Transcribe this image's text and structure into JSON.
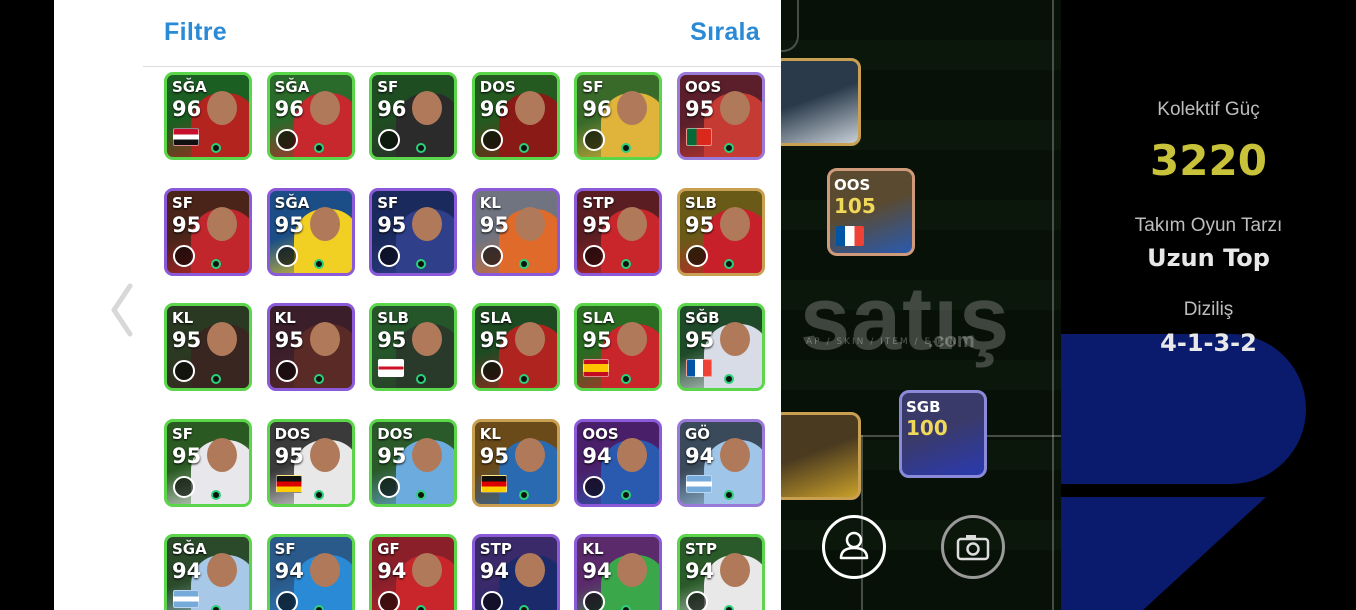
{
  "panel": {
    "filter_label": "Filtre",
    "sort_label": "Sırala"
  },
  "players": [
    {
      "pos": "SĞA",
      "ovr": "96",
      "flag": "egypt",
      "colors": [
        "#1c5f22",
        "#b3241f"
      ]
    },
    {
      "pos": "SĞA",
      "ovr": "96",
      "flag": "",
      "badge": "arsenal",
      "colors": [
        "#2a6a2a",
        "#c7282d"
      ]
    },
    {
      "pos": "SF",
      "ovr": "96",
      "flag": "",
      "badge": "madrid",
      "colors": [
        "#1f4d22",
        "#2b2b2b"
      ]
    },
    {
      "pos": "DOS",
      "ovr": "96",
      "flag": "",
      "badge": "milan",
      "colors": [
        "#245a20",
        "#8a1a16"
      ]
    },
    {
      "pos": "SF",
      "ovr": "96",
      "flag": "",
      "badge": "barcelona",
      "colors": [
        "#3a6a2a",
        "#e0b33a"
      ]
    },
    {
      "pos": "OOS",
      "ovr": "95",
      "flag": "portugal",
      "colors": [
        "#5a1f2a",
        "#c53a32"
      ]
    },
    {
      "pos": "SF",
      "ovr": "95",
      "flag": "",
      "badge": "liverpool",
      "colors": [
        "#4a2418",
        "#c1262d"
      ]
    },
    {
      "pos": "SĞA",
      "ovr": "95",
      "flag": "",
      "badge": "alnassr",
      "colors": [
        "#1b4e86",
        "#f2d023"
      ]
    },
    {
      "pos": "SF",
      "ovr": "95",
      "flag": "",
      "badge": "inter",
      "colors": [
        "#1a2a5c",
        "#2f3f8a"
      ]
    },
    {
      "pos": "KL",
      "ovr": "95",
      "flag": "",
      "badge": "madrid",
      "colors": [
        "#6f7480",
        "#e06a2a"
      ]
    },
    {
      "pos": "STP",
      "ovr": "95",
      "flag": "",
      "badge": "liverpool",
      "colors": [
        "#5a1e22",
        "#c9262b"
      ]
    },
    {
      "pos": "SLB",
      "ovr": "95",
      "flag": "",
      "badge": "manutd",
      "colors": [
        "#6a5a18",
        "#c8202a"
      ]
    },
    {
      "pos": "KL",
      "ovr": "95",
      "flag": "",
      "badge": "liverpool",
      "colors": [
        "#2a3a22",
        "#3a2620"
      ]
    },
    {
      "pos": "KL",
      "ovr": "95",
      "flag": "",
      "badge": "liverpool",
      "colors": [
        "#3a1e2a",
        "#5a2a26"
      ]
    },
    {
      "pos": "SLB",
      "ovr": "95",
      "flag": "england",
      "colors": [
        "#25562a",
        "#2a3a2a"
      ]
    },
    {
      "pos": "SLA",
      "ovr": "95",
      "flag": "",
      "badge": "milan",
      "colors": [
        "#1e4a22",
        "#b0241f"
      ]
    },
    {
      "pos": "SLA",
      "ovr": "95",
      "flag": "spain",
      "colors": [
        "#2a6a22",
        "#c9262b"
      ]
    },
    {
      "pos": "SĞB",
      "ovr": "95",
      "flag": "france",
      "colors": [
        "#1f4a2a",
        "#d8dce6"
      ]
    },
    {
      "pos": "SF",
      "ovr": "95",
      "flag": "",
      "badge": "madrid",
      "colors": [
        "#2a5a22",
        "#e8e8ec"
      ]
    },
    {
      "pos": "DOS",
      "ovr": "95",
      "flag": "germany",
      "colors": [
        "#3a3a3a",
        "#e8e8e8"
      ]
    },
    {
      "pos": "DOS",
      "ovr": "95",
      "flag": "",
      "badge": "mancity",
      "colors": [
        "#2a5a2a",
        "#6cabdd"
      ]
    },
    {
      "pos": "KL",
      "ovr": "95",
      "flag": "germany",
      "colors": [
        "#6a4a18",
        "#2a6ab0"
      ]
    },
    {
      "pos": "OOS",
      "ovr": "94",
      "flag": "",
      "badge": "sociedad",
      "colors": [
        "#4a1f6a",
        "#2a5ab0"
      ]
    },
    {
      "pos": "GÖ",
      "ovr": "94",
      "flag": "argentina",
      "colors": [
        "#3a4a5a",
        "#9fc6e8"
      ]
    },
    {
      "pos": "SĞA",
      "ovr": "94",
      "flag": "argentina",
      "colors": [
        "#2a4a2a",
        "#a8c8e8"
      ]
    },
    {
      "pos": "SF",
      "ovr": "94",
      "flag": "",
      "badge": "napoli",
      "colors": [
        "#2a5a8a",
        "#2a8ad6"
      ]
    },
    {
      "pos": "GF",
      "ovr": "94",
      "flag": "",
      "badge": "bayern",
      "colors": [
        "#8a1f2a",
        "#c9262b"
      ]
    },
    {
      "pos": "STP",
      "ovr": "94",
      "flag": "",
      "badge": "psg",
      "colors": [
        "#3a2a6a",
        "#1a2a6a"
      ]
    },
    {
      "pos": "KL",
      "ovr": "94",
      "flag": "",
      "badge": "barcelona",
      "colors": [
        "#5a2a6a",
        "#3aa84a"
      ]
    },
    {
      "pos": "STP",
      "ovr": "94",
      "flag": "",
      "badge": "realsociedad",
      "colors": [
        "#2a5a2a",
        "#e8e8e8"
      ]
    }
  ],
  "field_cards": [
    {
      "pos": "",
      "ovr": "",
      "flag": "",
      "colors": [
        "#2a3a4a",
        "#c8d0d8"
      ]
    },
    {
      "pos": "OOS",
      "ovr": "105",
      "flag": "france",
      "colors": [
        "#5a4a30",
        "#2a5ab0"
      ]
    },
    {
      "pos": "",
      "ovr": "",
      "flag": "",
      "colors": [
        "#4a3a20",
        "#c9a02a"
      ]
    },
    {
      "pos": "SGB",
      "ovr": "100",
      "flag": "",
      "badge": "barcelona",
      "colors": [
        "#3a3a6a",
        "#2a3ab0"
      ]
    }
  ],
  "watermark": {
    "brand": "satış",
    "tld": ".com",
    "tagline": "AP / SKIN / ITEM / E-PIN"
  },
  "stats": {
    "collective_label": "Kolektif Güç",
    "collective_value": "3220",
    "style_label": "Takım Oyun Tarzı",
    "style_value": "Uzun Top",
    "formation_label": "Diziliş",
    "formation_value": "4-1-3-2"
  },
  "colors": {
    "accent_blue": "#2a8ad6",
    "card_border_green": "#5bd64a",
    "card_border_purple": "#8a5ad8",
    "collective_gold": "#c8c23a",
    "deco_blue": "#0a1b6e"
  }
}
